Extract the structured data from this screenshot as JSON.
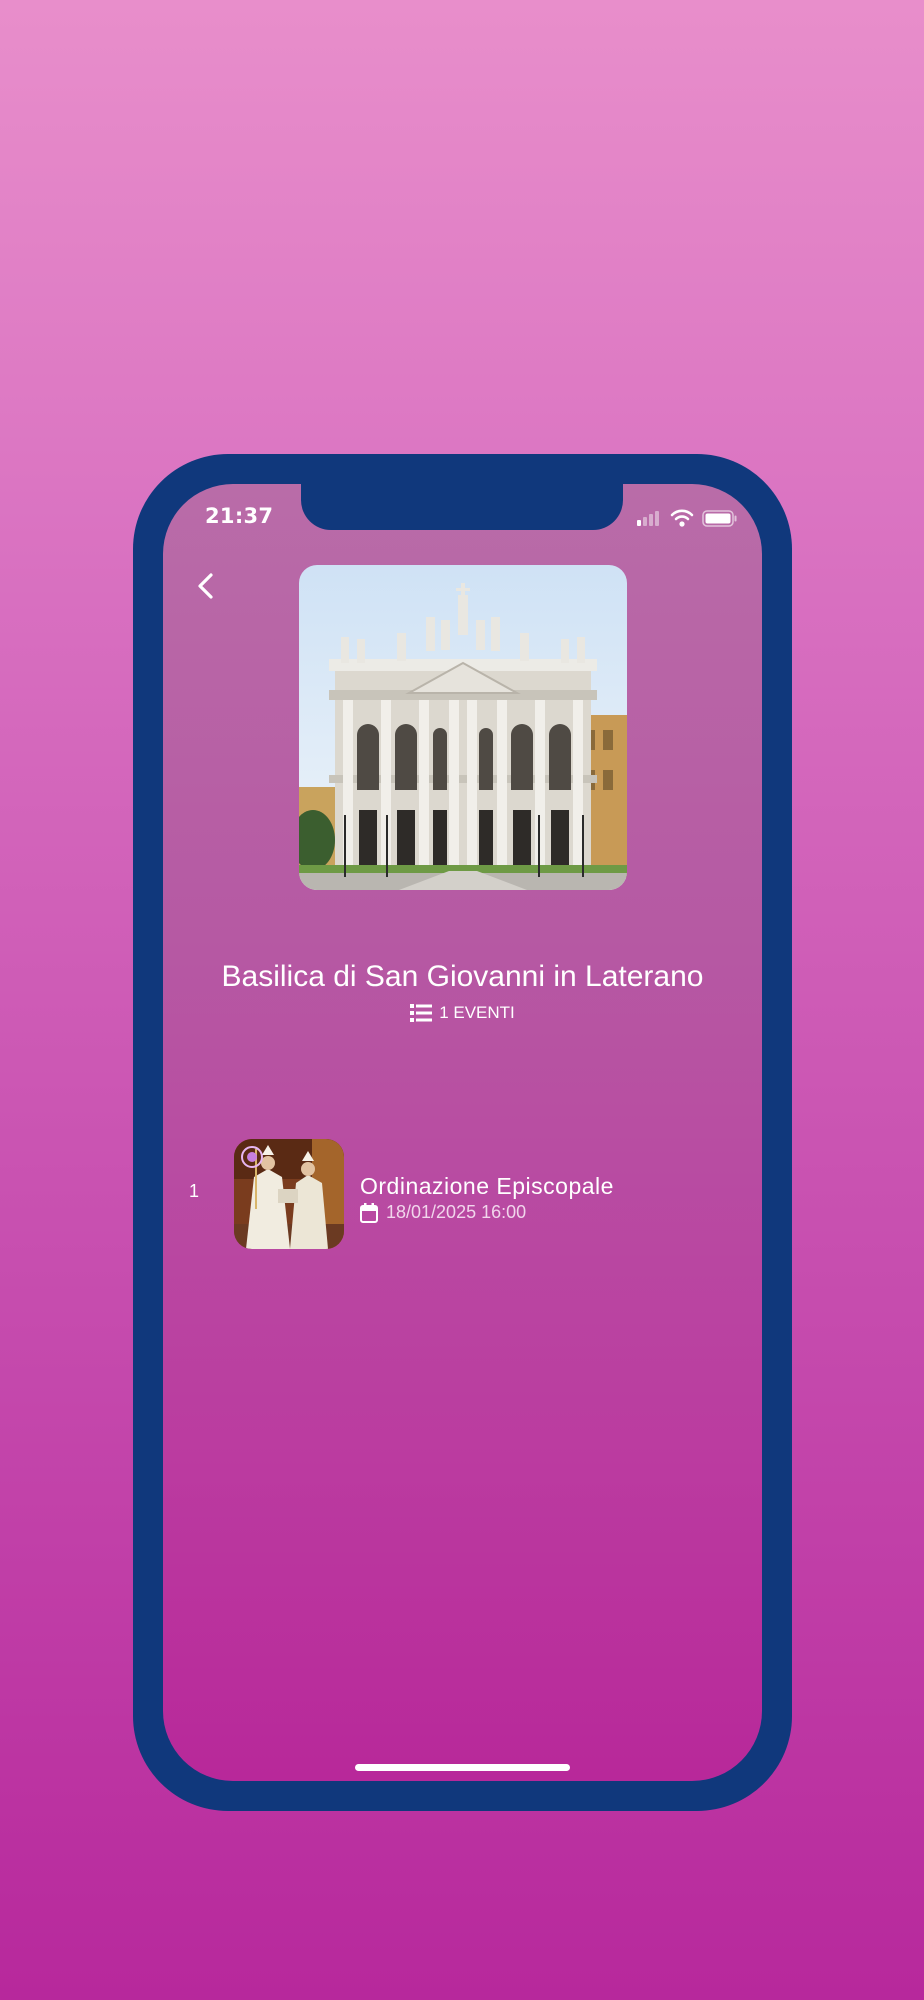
{
  "status_bar": {
    "time": "21:37"
  },
  "venue": {
    "title": "Basilica di San Giovanni in Laterano",
    "events_count": "1 EVENTI"
  },
  "events": [
    {
      "index": "1",
      "title": "Ordinazione Episcopale",
      "date": "18/01/2025 16:00"
    }
  ],
  "icons": {
    "back": "chevron-left-icon",
    "list": "list-icon",
    "calendar": "calendar-icon",
    "badge": "target-icon",
    "signal": "cellular-signal-icon",
    "wifi": "wifi-icon",
    "battery": "battery-icon"
  },
  "colors": {
    "background_top": "#e88ecb",
    "background_bottom": "#b7289c",
    "phone_frame": "#10387c",
    "text": "#ffffff"
  }
}
